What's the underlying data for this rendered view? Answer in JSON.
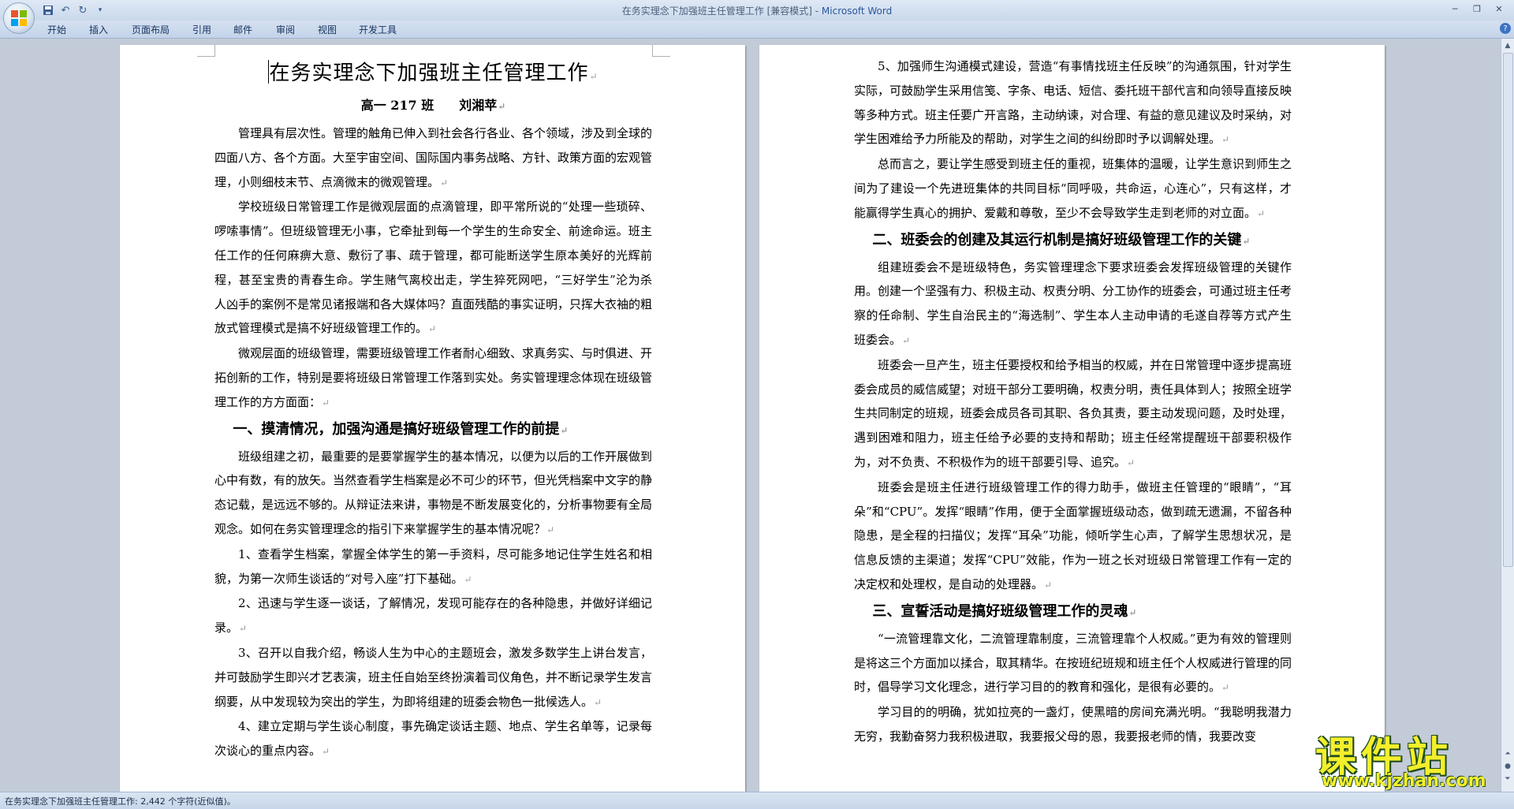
{
  "window": {
    "title_doc": "在务实理念下加强班主任管理工作 [兼容模式] - ",
    "title_app": "Microsoft Word"
  },
  "ribbon": {
    "tabs": [
      "开始",
      "插入",
      "页面布局",
      "引用",
      "邮件",
      "审阅",
      "视图",
      "开发工具"
    ]
  },
  "left_page": {
    "title": "在务实理念下加强班主任管理工作",
    "subtitle": "高一 217 班　　刘湘苹",
    "p1": "管理具有层次性。管理的触角已伸入到社会各行各业、各个领域，涉及到全球的四面八方、各个方面。大至宇宙空间、国际国内事务战略、方针、政策方面的宏观管理，小则细枝末节、点滴微末的微观管理。",
    "p2": "学校班级日常管理工作是微观层面的点滴管理，即平常所说的“处理一些琐碎、啰嗦事情”。但班级管理无小事，它牵扯到每一个学生的生命安全、前途命运。班主任工作的任何麻痹大意、敷衍了事、疏于管理，都可能断送学生原本美好的光辉前程，甚至宝贵的青春生命。学生赌气离校出走，学生猝死网吧，“三好学生”沦为杀人凶手的案例不是常见诸报端和各大媒体吗？直面残酷的事实证明，只挥大衣袖的粗放式管理模式是搞不好班级管理工作的。",
    "p3": "微观层面的班级管理，需要班级管理工作者耐心细致、求真务实、与时俱进、开拓创新的工作，特别是要将班级日常管理工作落到实处。务实管理理念体现在班级管理工作的方方面面：",
    "h1": "一、摸清情况，加强沟通是搞好班级管理工作的前提",
    "p4": "班级组建之初，最重要的是要掌握学生的基本情况，以便为以后的工作开展做到心中有数，有的放矢。当然查看学生档案是必不可少的环节，但光凭档案中文字的静态记载，是远远不够的。从辩证法来讲，事物是不断发展变化的，分析事物要有全局观念。如何在务实管理理念的指引下来掌握学生的基本情况呢？",
    "p5": "1、查看学生档案，掌握全体学生的第一手资料，尽可能多地记住学生姓名和相貌，为第一次师生谈话的“对号入座”打下基础。",
    "p6": "2、迅速与学生逐一谈话，了解情况，发现可能存在的各种隐患，并做好详细记录。",
    "p7": "3、召开以自我介绍，畅谈人生为中心的主题班会，激发多数学生上讲台发言，并可鼓励学生即兴才艺表演，班主任自始至终扮演着司仪角色，并不断记录学生发言纲要，从中发现较为突出的学生，为即将组建的班委会物色一批候选人。",
    "p8": "4、建立定期与学生谈心制度，事先确定谈话主题、地点、学生名单等，记录每次谈心的重点内容。"
  },
  "right_page": {
    "p1": "5、加强师生沟通模式建设，营造“有事情找班主任反映”的沟通氛围，针对学生实际，可鼓励学生采用信笺、字条、电话、短信、委托班干部代言和向领导直接反映等多种方式。班主任要广开言路，主动纳谏，对合理、有益的意见建议及时采纳，对学生困难给予力所能及的帮助，对学生之间的纠纷即时予以调解处理。",
    "p2": "总而言之，要让学生感受到班主任的重视，班集体的温暖，让学生意识到师生之间为了建设一个先进班集体的共同目标“同呼吸，共命运，心连心”，只有这样，才能赢得学生真心的拥护、爱戴和尊敬，至少不会导致学生走到老师的对立面。",
    "h2": "二、班委会的创建及其运行机制是搞好班级管理工作的关键",
    "p3": "组建班委会不是班级特色，务实管理理念下要求班委会发挥班级管理的关键作用。创建一个坚强有力、积极主动、权责分明、分工协作的班委会，可通过班主任考察的任命制、学生自治民主的“海选制”、学生本人主动申请的毛遂自荐等方式产生班委会。",
    "p4": "班委会一旦产生，班主任要授权和给予相当的权威，并在日常管理中逐步提高班委会成员的威信威望；对班干部分工要明确，权责分明，责任具体到人；按照全班学生共同制定的班规，班委会成员各司其职、各负其责，要主动发现问题，及时处理，遇到困难和阻力，班主任给予必要的支持和帮助；班主任经常提醒班干部要积极作为，对不负责、不积极作为的班干部要引导、追究。",
    "p5": "班委会是班主任进行班级管理工作的得力助手，做班主任管理的“眼睛”，“耳朵”和“CPU”。发挥“眼睛”作用，便于全面掌握班级动态，做到疏无遗漏，不留各种隐患，是全程的扫描仪；发挥“耳朵”功能，倾听学生心声，了解学生思想状况，是信息反馈的主渠道；发挥“CPU”效能，作为一班之长对班级日常管理工作有一定的决定权和处理权，是自动的处理器。",
    "h3": "三、宣誓活动是搞好班级管理工作的灵魂",
    "p6": "“一流管理靠文化，二流管理靠制度，三流管理靠个人权威。”更为有效的管理则是将这三个方面加以揉合，取其精华。在按班纪班规和班主任个人权威进行管理的同时，倡导学习文化理念，进行学习目的的教育和强化，是很有必要的。",
    "p7": "学习目的的明确，犹如拉亮的一盏灯，使黑暗的房间充满光明。“我聪明我潜力无穷，我勤奋努力我积极进取，我要报父母的恩，我要报老师的情，我要改变"
  },
  "status": {
    "text": "在务实理念下加强班主任管理工作: 2,442 个字符(近似值)。"
  },
  "watermark": {
    "main": "课件站",
    "url": "www.kjzhan.com"
  },
  "icons": {
    "office": "office-button-icon",
    "save": "save-icon",
    "undo": "undo-icon",
    "redo": "redo-icon",
    "customize": "customize-qat-icon",
    "help": "help-icon"
  },
  "colors": {
    "accent": "#2b579a",
    "watermark_yellow": "#f4ef2c"
  }
}
